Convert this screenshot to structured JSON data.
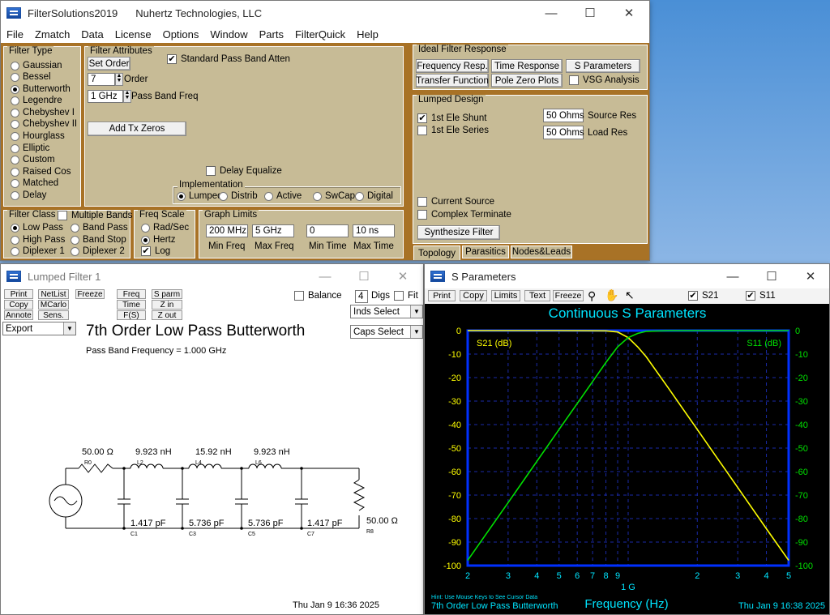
{
  "main_window": {
    "title": "FilterSolutions2019",
    "company": "Nuhertz Technologies, LLC",
    "menu": [
      "File",
      "Zmatch",
      "Data",
      "License",
      "Options",
      "Window",
      "Parts",
      "FilterQuick",
      "Help"
    ]
  },
  "filter_type": {
    "label": "Filter Type",
    "options": [
      "Gaussian",
      "Bessel",
      "Butterworth",
      "Legendre",
      "Chebyshev I",
      "Chebyshev II",
      "Hourglass",
      "Elliptic",
      "Custom",
      "Raised Cos",
      "Matched",
      "Delay"
    ],
    "selected": "Butterworth"
  },
  "filter_attributes": {
    "label": "Filter Attributes",
    "set_order": "Set Order",
    "std_pass_band_atten": "Standard Pass Band Atten",
    "order_value": "7",
    "order_label": "Order",
    "pbf_value": "1 GHz",
    "pbf_label": "Pass Band Freq",
    "add_tx_zeros": "Add Tx Zeros",
    "delay_equalize": "Delay Equalize",
    "implementation_label": "Implementation",
    "implementation": [
      "Lumped",
      "Distrib",
      "Active",
      "SwCap",
      "Digital"
    ]
  },
  "filter_class": {
    "label": "Filter Class",
    "multiple_bands": "Multiple Bands",
    "options": [
      "Low Pass",
      "Band Pass",
      "High Pass",
      "Band Stop",
      "Diplexer 1",
      "Diplexer 2"
    ],
    "selected": "Low Pass"
  },
  "freq_scale": {
    "label": "Freq Scale",
    "options": [
      "Rad/Sec",
      "Hertz"
    ],
    "selected": "Hertz",
    "log": "Log"
  },
  "graph_limits": {
    "label": "Graph Limits",
    "min_freq": "200 MHz",
    "max_freq": "5 GHz",
    "min_time": "0",
    "max_time": "10 ns",
    "min_freq_label": "Min Freq",
    "max_freq_label": "Max Freq",
    "min_time_label": "Min Time",
    "max_time_label": "Max Time"
  },
  "ideal_response": {
    "label": "Ideal Filter Response",
    "buttons": [
      "Frequency Resp.",
      "Time Response",
      "S Parameters",
      "Transfer Function",
      "Pole Zero Plots"
    ],
    "vsg": "VSG Analysis"
  },
  "lumped_design": {
    "label": "Lumped Design",
    "first_shunt": "1st Ele Shunt",
    "first_series": "1st Ele Series",
    "source_res": "50 Ohms",
    "source_res_label": "Source Res",
    "load_res": "50 Ohms",
    "load_res_label": "Load Res",
    "current_source": "Current Source",
    "complex_terminate": "Complex Terminate",
    "synthesize": "Synthesize Filter",
    "tabs": [
      "Topology",
      "Parasitics",
      "Nodes&Leads"
    ]
  },
  "lumped_window": {
    "title": "Lumped Filter 1",
    "buttons": [
      "Print",
      "NetList",
      "Freeze",
      "Freq",
      "S parm",
      "Copy",
      "MCarlo",
      "Time",
      "Z in",
      "Annote",
      "Sens.",
      "F(S)",
      "Z out"
    ],
    "balance": "Balance",
    "digs_value": "4",
    "digs_label": "Digs",
    "fit": "Fit",
    "inds_select": "Inds Select",
    "caps_select": "Caps Select",
    "export": "Export",
    "heading": "7th Order Low Pass Butterworth",
    "subheading": "Pass Band Frequency = 1.000 GHz",
    "components": {
      "r0_val": "50.00 Ω",
      "r0": "R0",
      "l2_val": "9.923 nH",
      "l2": "L2",
      "l4_val": "15.92 nH",
      "l4": "L4",
      "l6_val": "9.923 nH",
      "l6": "L6",
      "c1_val": "1.417 pF",
      "c1": "C1",
      "c3_val": "5.736 pF",
      "c3": "C3",
      "c5_val": "5.736 pF",
      "c5": "C5",
      "c7_val": "1.417 pF",
      "c7": "C7",
      "r8_val": "50.00 Ω",
      "r8": "R8"
    },
    "timestamp": "Thu Jan  9 16:36 2025"
  },
  "sparam_window": {
    "title": "S Parameters",
    "toolbar": [
      "Print",
      "Copy",
      "Limits",
      "Text",
      "Freeze"
    ],
    "s21": "S21",
    "s11": "S11",
    "hint": "Hint: Use Mouse Keys to See Cursor Data",
    "footer_title": "7th Order Low Pass Butterworth",
    "timestamp": "Thu Jan  9 16:38 2025"
  },
  "chart_data": {
    "type": "line",
    "title": "Continuous S Parameters",
    "xlabel": "Frequency (Hz)",
    "x_scale": "log",
    "xlim": [
      200000000,
      5000000000
    ],
    "x_tick_labels": [
      "2",
      "3",
      "4",
      "5",
      "6",
      "7",
      "8",
      "9",
      "1 G",
      "2",
      "3",
      "4",
      "5"
    ],
    "ylim": [
      -100,
      0
    ],
    "y_tick_labels": [
      "0",
      "-10",
      "-20",
      "-30",
      "-40",
      "-50",
      "-60",
      "-70",
      "-80",
      "-90",
      "-100"
    ],
    "left_axis_label": "S21 (dB)",
    "right_axis_label": "S11 (dB)",
    "grid": true,
    "series": [
      {
        "name": "S21",
        "color": "#ffff00",
        "x": [
          200000000,
          500000000,
          800000000,
          900000000,
          1000000000,
          1100000000,
          1200000000,
          1500000000,
          2000000000,
          3000000000,
          4000000000,
          5000000000
        ],
        "values": [
          0,
          0,
          -0.1,
          -0.6,
          -3,
          -6.9,
          -11.2,
          -24.6,
          -42.1,
          -66.8,
          -84.3,
          -97.8
        ]
      },
      {
        "name": "S11",
        "color": "#00e000",
        "x": [
          200000000,
          300000000,
          500000000,
          700000000,
          800000000,
          900000000,
          1000000000,
          1100000000,
          1200000000,
          1500000000,
          2000000000,
          5000000000
        ],
        "values": [
          -97.8,
          -73.2,
          -42.1,
          -21.7,
          -13.6,
          -6.9,
          -3,
          -1.2,
          -0.3,
          0,
          0,
          0
        ]
      }
    ]
  }
}
